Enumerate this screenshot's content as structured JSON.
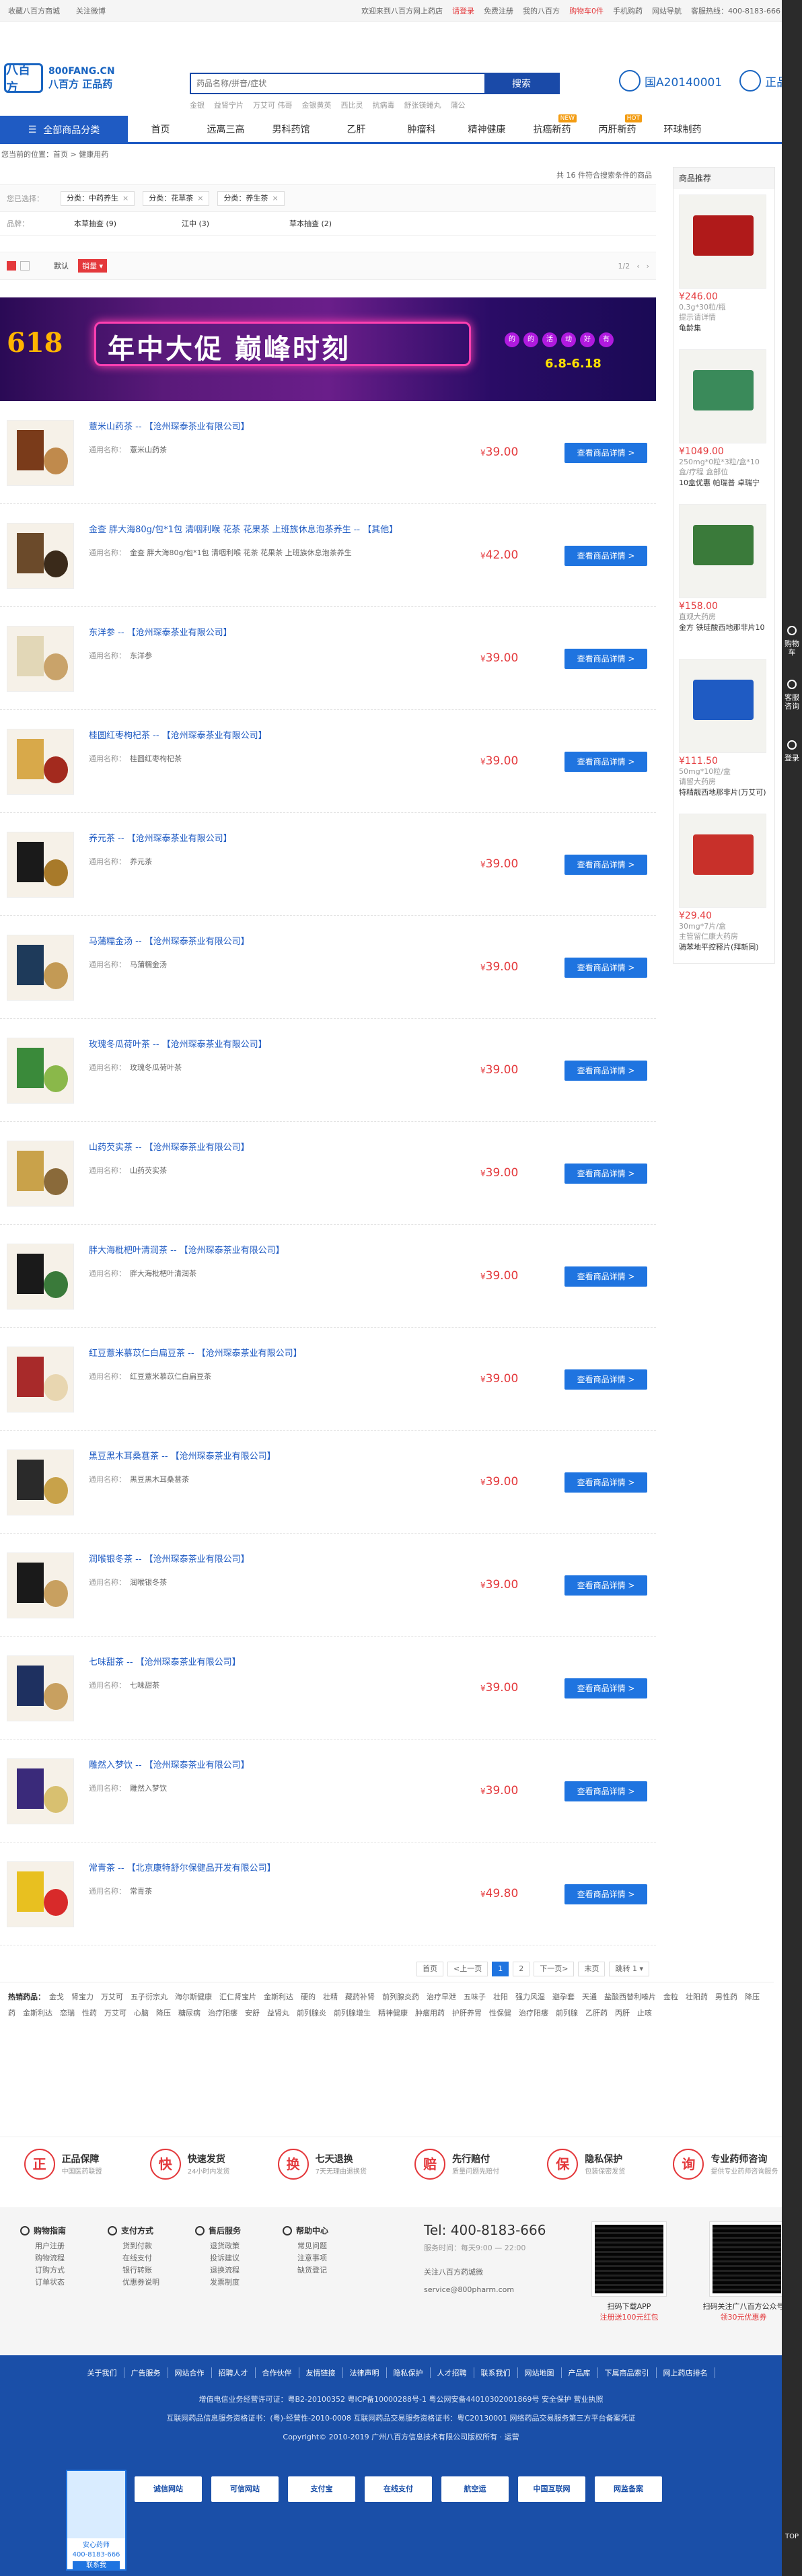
{
  "topbar": {
    "collect": "收藏八百方商城",
    "follow": "关注微博",
    "welcome": "欢迎来到八百方网上药店",
    "login": "请登录",
    "register": "免费注册",
    "my": "我的八百方",
    "cart": "购物车0件",
    "mobile": "手机购药",
    "nav": "网站导航",
    "service": "客服热线：400-8183-666"
  },
  "header": {
    "logo_mark": "八百方",
    "logo_line1": "800FANG.CN",
    "logo_line2": "八百方 正品药",
    "search_placeholder": "药品名称/拼音/症状",
    "search_button": "搜索",
    "hot_words": [
      "金银",
      "益肾宁片",
      "万艾可 伟哥",
      "金银黄英",
      "西比灵",
      "抗病毒",
      "舒张镁蜷丸",
      "蒲公"
    ],
    "badge1": "国A20140001",
    "badge2": "正品"
  },
  "nav": {
    "all_categories": "全部商品分类",
    "items": [
      {
        "label": "首页",
        "tag": ""
      },
      {
        "label": "远离三高",
        "tag": ""
      },
      {
        "label": "男科药馆",
        "tag": ""
      },
      {
        "label": "乙肝",
        "tag": ""
      },
      {
        "label": "肿瘤科",
        "tag": ""
      },
      {
        "label": "精神健康",
        "tag": ""
      },
      {
        "label": "抗癌新药",
        "tag": "NEW"
      },
      {
        "label": "丙肝新药",
        "tag": "HOT"
      },
      {
        "label": "环球制药",
        "tag": ""
      }
    ]
  },
  "breadcrumb": "您当前的位置：首页 > 健康用药",
  "results": {
    "count_text": "共 16 件符合搜索条件的商品",
    "filter_label": "您已选择：",
    "chips": [
      "分类：中药养生",
      "分类：花草茶",
      "分类：养生茶"
    ],
    "brand_label": "品牌：",
    "brands": [
      "本草抽查 (9)",
      "江中 (3)",
      "草本抽查 (2)"
    ],
    "sort_default": "默认",
    "sort_sales": "销量",
    "page_info": "1/2"
  },
  "banner": {
    "prefix": "618",
    "main": "年中大促 巅峰时刻",
    "date": "6.8-6.18",
    "dots": [
      "的",
      "的",
      "活",
      "动",
      "好",
      "有"
    ]
  },
  "products": [
    {
      "title": "薏米山药茶 -- 【沧州琛泰茶业有限公司】",
      "gen_key": "通用名称：",
      "gen_val": "薏米山药茶",
      "price": "39.00",
      "button": "查看商品详情 >",
      "c1": "#7a3b1a",
      "c2": "#c08a4c"
    },
    {
      "title": "金查 胖大海80g/包*1包 清咽利喉 花茶 花果茶 上班族休息泡茶养生 -- 【其他】",
      "gen_key": "通用名称：",
      "gen_val": "金查 胖大海80g/包*1包 清咽利喉 花茶 花果茶 上班族休息泡茶养生",
      "price": "42.00",
      "button": "查看商品详情 >",
      "c1": "#6b4a2a",
      "c2": "#3a2a1a"
    },
    {
      "title": "东洋参 -- 【沧州琛泰茶业有限公司】",
      "gen_key": "通用名称：",
      "gen_val": "东洋参",
      "price": "39.00",
      "button": "查看商品详情 >",
      "c1": "#e2d7b7",
      "c2": "#c9a36a"
    },
    {
      "title": "桂圆红枣枸杞茶 -- 【沧州琛泰茶业有限公司】",
      "gen_key": "通用名称：",
      "gen_val": "桂圆红枣枸杞茶",
      "price": "39.00",
      "button": "查看商品详情 >",
      "c1": "#d8a94a",
      "c2": "#a32a1e"
    },
    {
      "title": "养元茶 -- 【沧州琛泰茶业有限公司】",
      "gen_key": "通用名称：",
      "gen_val": "养元茶",
      "price": "39.00",
      "button": "查看商品详情 >",
      "c1": "#1a1a1a",
      "c2": "#a87a2a"
    },
    {
      "title": "马蒲糯金汤 -- 【沧州琛泰茶业有限公司】",
      "gen_key": "通用名称：",
      "gen_val": "马蒲糯金汤",
      "price": "39.00",
      "button": "查看商品详情 >",
      "c1": "#1e3a5a",
      "c2": "#c39a55"
    },
    {
      "title": "玫瑰冬瓜荷叶茶 -- 【沧州琛泰茶业有限公司】",
      "gen_key": "通用名称：",
      "gen_val": "玫瑰冬瓜荷叶茶",
      "price": "39.00",
      "button": "查看商品详情 >",
      "c1": "#3a8a3a",
      "c2": "#8ab84a"
    },
    {
      "title": "山药芡实茶 -- 【沧州琛泰茶业有限公司】",
      "gen_key": "通用名称：",
      "gen_val": "山药芡实茶",
      "price": "39.00",
      "button": "查看商品详情 >",
      "c1": "#c9a24a",
      "c2": "#8a6a3a"
    },
    {
      "title": "胖大海枇杷叶清润茶 -- 【沧州琛泰茶业有限公司】",
      "gen_key": "通用名称：",
      "gen_val": "胖大海枇杷叶清润茶",
      "price": "39.00",
      "button": "查看商品详情 >",
      "c1": "#1a1a1a",
      "c2": "#3a7a3a"
    },
    {
      "title": "红豆薏米慕苡仁白扁豆茶 -- 【沧州琛泰茶业有限公司】",
      "gen_key": "通用名称：",
      "gen_val": "红豆薏米慕苡仁白扁豆茶",
      "price": "39.00",
      "button": "查看商品详情 >",
      "c1": "#a82a2a",
      "c2": "#e8d6b0"
    },
    {
      "title": "黑豆黑木耳桑葚茶 -- 【沧州琛泰茶业有限公司】",
      "gen_key": "通用名称：",
      "gen_val": "黑豆黑木耳桑葚茶",
      "price": "39.00",
      "button": "查看商品详情 >",
      "c1": "#2a2a2a",
      "c2": "#c8a24a"
    },
    {
      "title": "润喉银冬茶 -- 【沧州琛泰茶业有限公司】",
      "gen_key": "通用名称：",
      "gen_val": "润喉银冬茶",
      "price": "39.00",
      "button": "查看商品详情 >",
      "c1": "#1a1a1a",
      "c2": "#c8a060"
    },
    {
      "title": "七味甜茶 -- 【沧州琛泰茶业有限公司】",
      "gen_key": "通用名称：",
      "gen_val": "七味甜茶",
      "price": "39.00",
      "button": "查看商品详情 >",
      "c1": "#1e3060",
      "c2": "#c8a060"
    },
    {
      "title": "雕然入梦饮 -- 【沧州琛泰茶业有限公司】",
      "gen_key": "通用名称：",
      "gen_val": "雕然入梦饮",
      "price": "39.00",
      "button": "查看商品详情 >",
      "c1": "#3a2a7a",
      "c2": "#d8c070"
    },
    {
      "title": "常青茶 -- 【北京康特舒尔保健品开发有限公司】",
      "gen_key": "通用名称：",
      "gen_val": "常青茶",
      "price": "49.80",
      "button": "查看商品详情 >",
      "c1": "#e8c020",
      "c2": "#d82a2a"
    }
  ],
  "pager_bottom": [
    "首页",
    "<上一页",
    "1",
    "2",
    "下一页>",
    "末页",
    "跳转 1 ▾"
  ],
  "sidebar": {
    "title": "商品推荐",
    "items": [
      {
        "price": "¥246.00",
        "spec": "0.3g*30粒/瓶",
        "spec2": "提示请详情",
        "name": "龟龄集",
        "c": "#b01a1a"
      },
      {
        "price": "¥1049.00",
        "spec": "250mg*0粒*3粒/盒*10",
        "spec2": "盒/疗程 盒部位",
        "name": "10盒优惠 帕瑞普 卓瑞宁",
        "c": "#3a8a5a"
      },
      {
        "price": "¥158.00",
        "spec": "",
        "spec2": "直观大药房",
        "name": "金方 铁硅酸西地那非片10",
        "c": "#3a7a3a"
      },
      {
        "price": "¥111.50",
        "spec": "50mg*10粒/盒",
        "spec2": "请留大药房",
        "name": "特精靓西地那非片(万艾可)",
        "c": "#1f5bc3"
      },
      {
        "price": "¥29.40",
        "spec": "30mg*7片/盒",
        "spec2": "主管留仁康大药房",
        "name": "骑苯地平控释片(拜新同)",
        "c": "#c8302a"
      }
    ]
  },
  "hotwords": {
    "label": "热销药品：",
    "words": [
      "金戈",
      "肾宝力",
      "万艾可",
      "五子衍宗丸",
      "海尔斯健康",
      "汇仁肾宝片",
      "金斯利达",
      "硬的",
      "壮精",
      "藏药补肾",
      "前列腺炎药",
      "治疗早泄",
      "五味子",
      "壮阳",
      "强力风湿",
      "避孕套",
      "天通",
      "盐酸西替利嗪片",
      "金粒",
      "壮阳药",
      "男性药",
      "降压药",
      "金斯利达",
      "恋瑞",
      "性药",
      "万艾可",
      "心脑",
      "降压",
      "糖尿病",
      "治疗阳痿",
      "安舒",
      "益肾丸",
      "前列腺炎",
      "前列腺增生",
      "精神健康",
      "肿瘤用药",
      "护肝养胃",
      "性保健",
      "治疗阳痿",
      "前列腺",
      "乙肝药",
      "丙肝",
      "止咳"
    ]
  },
  "guarantee": [
    {
      "icon": "正",
      "t1": "正品保障",
      "t2": "中国医药联盟"
    },
    {
      "icon": "快",
      "t1": "快速发货",
      "t2": "24小时内发货"
    },
    {
      "icon": "换",
      "t1": "七天退换",
      "t2": "7天无理由退换货"
    },
    {
      "icon": "赔",
      "t1": "先行赔付",
      "t2": "质量问题先赔付"
    },
    {
      "icon": "保",
      "t1": "隐私保护",
      "t2": "包装保密发货"
    },
    {
      "icon": "询",
      "t1": "专业药师咨询",
      "t2": "提供专业药师咨询服务"
    }
  ],
  "help": {
    "cols": [
      {
        "h": "购物指南",
        "items": [
          "用户注册",
          "购物流程",
          "订购方式",
          "订单状态"
        ]
      },
      {
        "h": "支付方式",
        "items": [
          "货到付款",
          "在线支付",
          "银行转账",
          "优惠券说明"
        ]
      },
      {
        "h": "售后服务",
        "items": [
          "退货政策",
          "投诉建议",
          "退换流程",
          "发票制度"
        ]
      },
      {
        "h": "帮助中心",
        "items": [
          "常见问题",
          "注意事项",
          "缺货登记"
        ]
      }
    ],
    "phone": "Tel: 400-8183-666",
    "phone_sub": "服务时间：每天9:00 — 22:00",
    "contact1": "关注八百方药城微",
    "contact2": "service@800pharm.com",
    "qr1_t1": "扫码下载APP",
    "qr1_t2": "注册送100元红包",
    "qr2_t1": "扫码关注广八百方公众号",
    "qr2_t2": "领30元优惠券"
  },
  "footer": {
    "links": [
      "关于我们",
      "广告服务",
      "网站合作",
      "招聘人才",
      "合作伙伴",
      "友情链接",
      "法律声明",
      "隐私保护",
      "人才招聘",
      "联系我们",
      "网站地图",
      "产品库",
      "下属商品索引",
      "网上药店排名"
    ],
    "line1": "增值电信业务经营许可证：粤B2-20100352  粤ICP备10000288号-1  粤公网安备44010302001869号  安全保护  营业执照",
    "line2": "互联网药品信息服务资格证书：(粤)-经营性-2010-0008  互联网药品交易服务资格证书：粤C20130001  网络药品交易服务第三方平台备案凭证",
    "line3": "Copyright© 2010-2019 广州八百方信息技术有限公司版权所有 · 运营",
    "certs": [
      "诚信网站",
      "可信网站",
      "支付宝",
      "在线支付",
      "航空运",
      "中国互联网",
      "网监备案"
    ],
    "nurse_text": "安心药师",
    "nurse_phone": "400-8183-666",
    "nurse_btn": "联系我"
  },
  "rail": {
    "r1": "购物车",
    "r2": "客服咨询",
    "r3": "登录",
    "top": "TOP"
  }
}
